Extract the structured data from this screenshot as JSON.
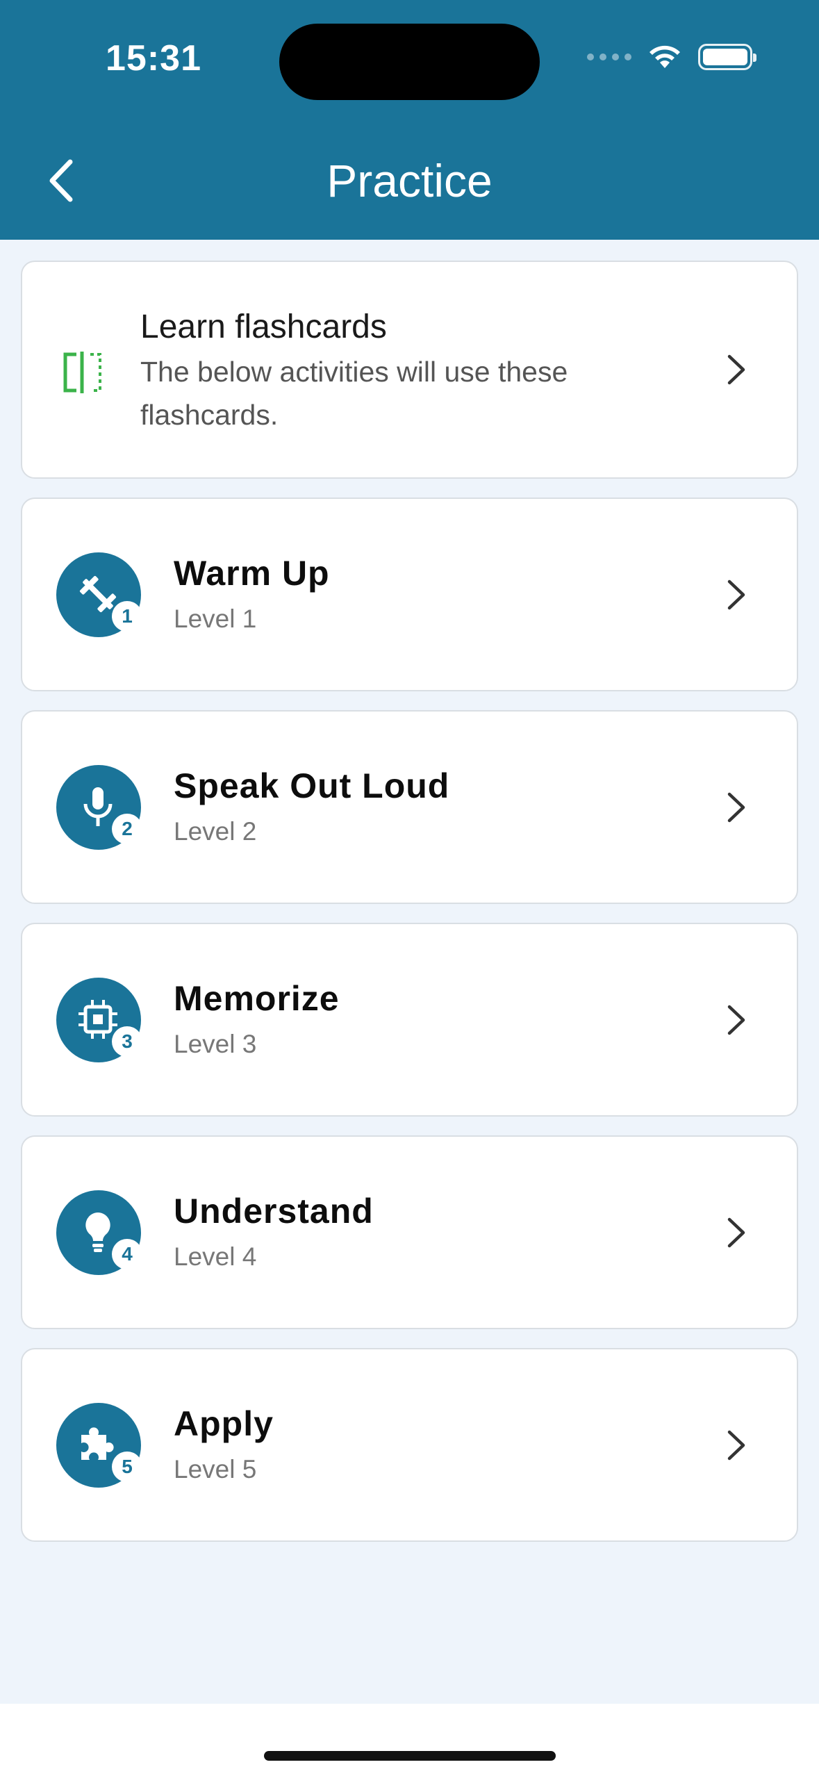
{
  "status": {
    "time": "15:31"
  },
  "header": {
    "title": "Practice"
  },
  "flashcards": {
    "icon": "split-cards-icon",
    "title": "Learn flashcards",
    "description": "The below activities will use these flashcards."
  },
  "levels": [
    {
      "title": "Warm Up",
      "subtitle": "Level 1",
      "badge": "1",
      "icon": "dumbbell-icon"
    },
    {
      "title": "Speak Out Loud",
      "subtitle": "Level 2",
      "badge": "2",
      "icon": "microphone-icon"
    },
    {
      "title": "Memorize",
      "subtitle": "Level 3",
      "badge": "3",
      "icon": "chip-icon"
    },
    {
      "title": "Understand",
      "subtitle": "Level 4",
      "badge": "4",
      "icon": "lightbulb-icon"
    },
    {
      "title": "Apply",
      "subtitle": "Level 5",
      "badge": "5",
      "icon": "puzzle-icon"
    }
  ],
  "colors": {
    "header": "#1a7499",
    "accent_green": "#3bb34a",
    "background": "#eef4fb"
  }
}
